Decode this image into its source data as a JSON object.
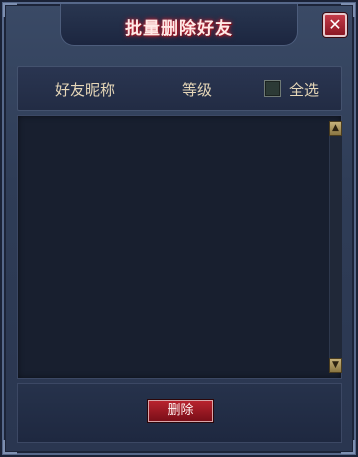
{
  "window": {
    "title": "批量删除好友",
    "close_icon": "close-icon"
  },
  "header": {
    "name_column": "好友昵称",
    "level_column": "等级",
    "select_all_label": "全选",
    "select_all_checked": false
  },
  "list": {
    "items": []
  },
  "scrollbar": {
    "up_icon": "chevron-up-icon",
    "down_icon": "chevron-down-icon"
  },
  "footer": {
    "delete_label": "删除"
  }
}
